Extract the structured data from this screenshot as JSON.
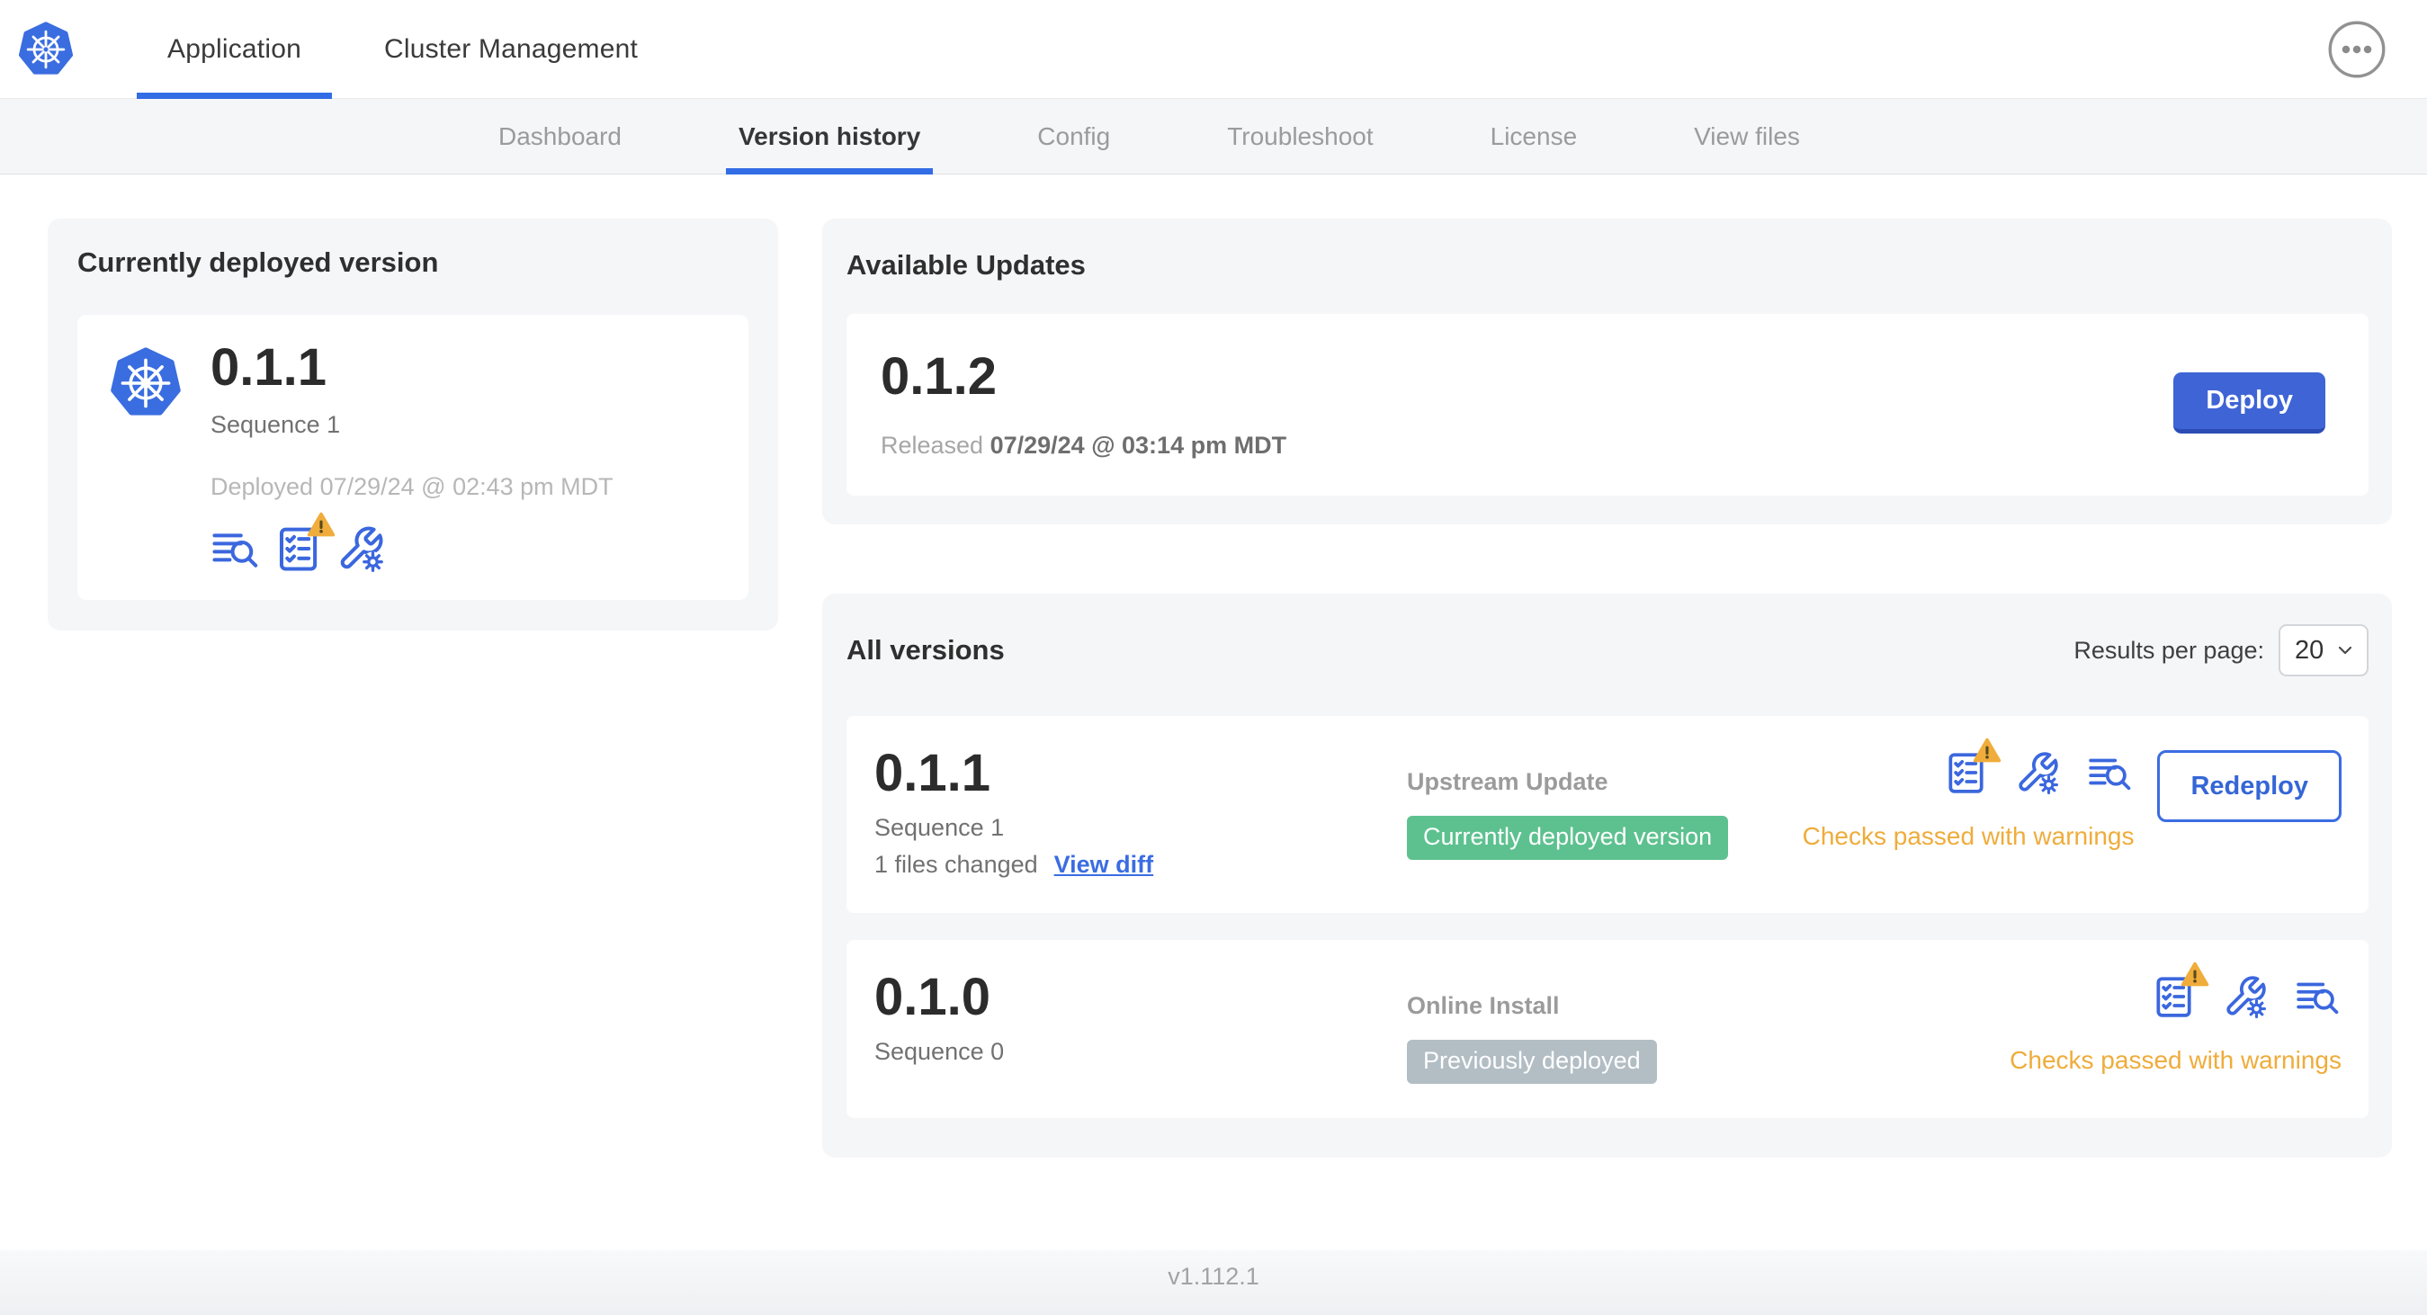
{
  "header": {
    "tabs": [
      {
        "label": "Application",
        "active": true
      },
      {
        "label": "Cluster Management",
        "active": false
      }
    ],
    "menu_icon": "ellipsis-icon",
    "logo_icon": "kubernetes-logo"
  },
  "subnav": {
    "tabs": [
      {
        "label": "Dashboard",
        "active": false
      },
      {
        "label": "Version history",
        "active": true
      },
      {
        "label": "Config",
        "active": false
      },
      {
        "label": "Troubleshoot",
        "active": false
      },
      {
        "label": "License",
        "active": false
      },
      {
        "label": "View files",
        "active": false
      }
    ]
  },
  "current_version_card": {
    "title": "Currently deployed version",
    "version": "0.1.1",
    "sequence": "Sequence 1",
    "deployed_at": "Deployed 07/29/24 @ 02:43 pm MDT",
    "icons": [
      "release-notes-icon",
      "preflight-checks-warning-icon",
      "edit-config-icon"
    ]
  },
  "available_updates": {
    "title": "Available Updates",
    "update": {
      "version": "0.1.2",
      "released_label": "Released",
      "released_at": "07/29/24 @ 03:14 pm MDT",
      "deploy_label": "Deploy"
    }
  },
  "all_versions": {
    "title": "All versions",
    "results_per_page_label": "Results per page:",
    "results_per_page_value": "20",
    "rows": [
      {
        "version": "0.1.1",
        "sequence": "Sequence 1",
        "files_changed": "1 files changed",
        "view_diff_label": "View diff",
        "source": "Upstream Update",
        "status_badge": "Currently deployed version",
        "badge_color": "#5dc18f",
        "icons": [
          "preflight-checks-warning-icon",
          "edit-config-icon",
          "release-notes-icon"
        ],
        "checks_text": "Checks passed with warnings",
        "action_label": "Redeploy"
      },
      {
        "version": "0.1.0",
        "sequence": "Sequence 0",
        "source": "Online Install",
        "status_badge": "Previously deployed",
        "badge_color": "#b2bdc4",
        "icons": [
          "preflight-checks-warning-icon",
          "edit-config-icon",
          "release-notes-icon"
        ],
        "checks_text": "Checks passed with warnings"
      }
    ]
  },
  "footer": {
    "app_version": "v1.112.1"
  },
  "colors": {
    "accent_blue": "#3b6ce2",
    "active_tab_underline": "#326de6",
    "k8s_logo_blue": "#3a6de0",
    "deploy_button_blue": "#3e64d6",
    "badge_green": "#5dc18f",
    "badge_gray": "#b2bdc4",
    "warning_orange": "#efac3b",
    "panel_background": "#f5f6f8"
  }
}
